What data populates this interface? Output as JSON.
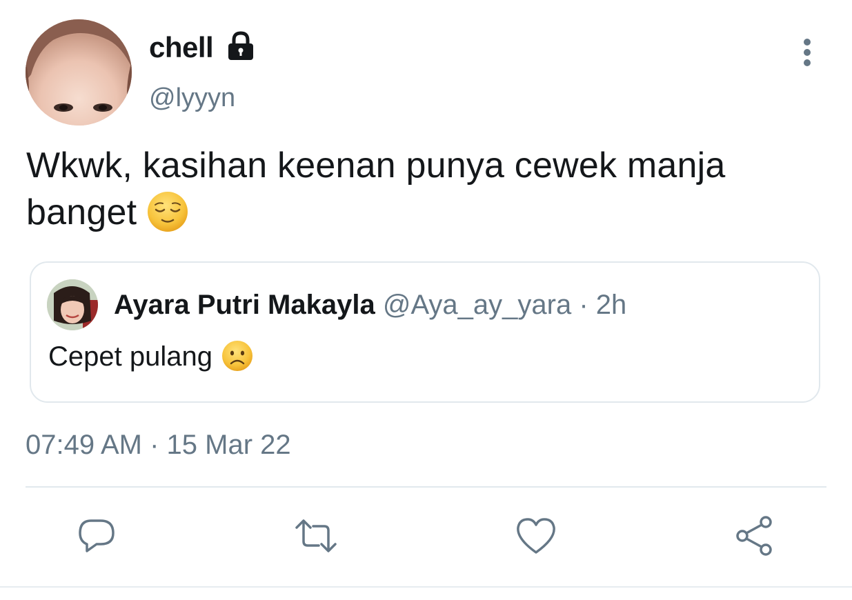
{
  "author": {
    "display_name": "chell",
    "handle": "@lyyyn",
    "protected_icon": "lock-icon"
  },
  "more_icon": "more-vertical-icon",
  "tweet": {
    "text": "Wkwk, kasihan keenan punya cewek manja banget",
    "emoji": "relieved-face-emoji"
  },
  "quoted_tweet": {
    "display_name": "Ayara Putri Makayla",
    "handle": "@Aya_ay_yara",
    "separator": "·",
    "time": "2h",
    "text": "Cepet pulang",
    "emoji": "frowning-face-emoji"
  },
  "timestamp": "07:49 AM · 15 Mar 22",
  "actions": [
    {
      "icon": "reply-icon"
    },
    {
      "icon": "retweet-icon"
    },
    {
      "icon": "like-icon"
    },
    {
      "icon": "share-icon"
    }
  ],
  "colors": {
    "text_primary": "#14171a",
    "text_secondary": "#657786",
    "border": "#e1e8ed",
    "emoji_yellow": "#f7c33b"
  }
}
